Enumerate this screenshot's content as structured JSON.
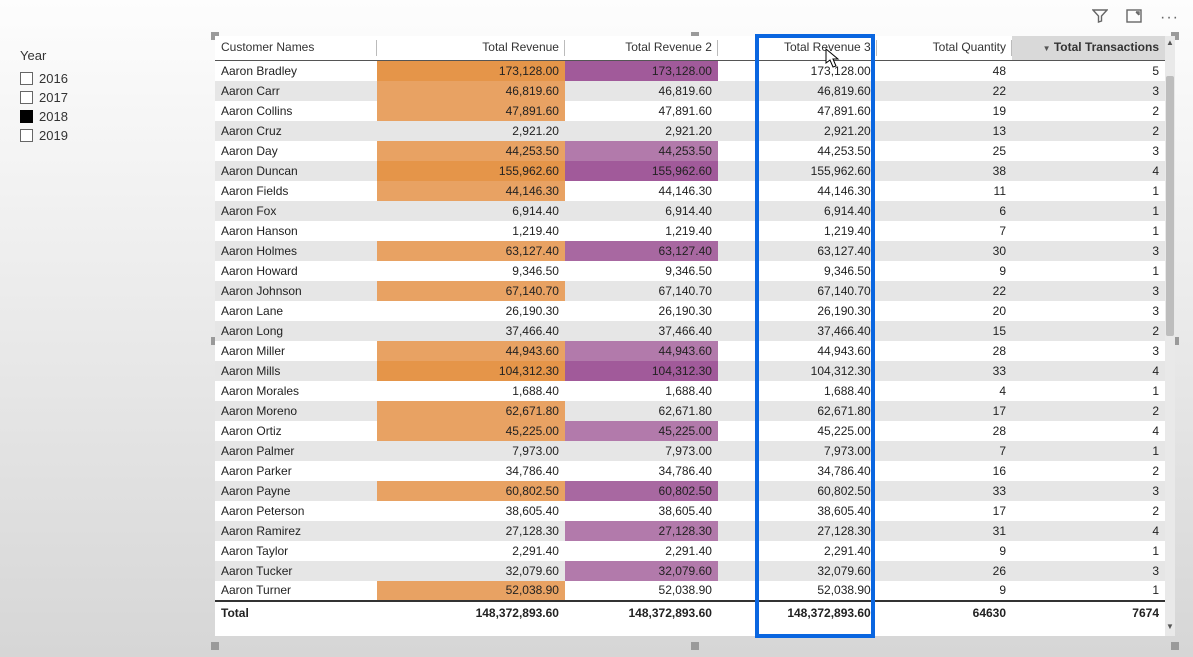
{
  "toolbar": {
    "filter_icon": "filter",
    "focus_icon": "focus-mode",
    "more_icon": "more"
  },
  "slicer": {
    "title": "Year",
    "items": [
      {
        "label": "2016",
        "checked": false
      },
      {
        "label": "2017",
        "checked": false
      },
      {
        "label": "2018",
        "checked": true
      },
      {
        "label": "2019",
        "checked": false
      }
    ]
  },
  "table": {
    "columns": [
      {
        "label": "Customer Names",
        "align": "left"
      },
      {
        "label": "Total Revenue",
        "align": "right"
      },
      {
        "label": "Total Revenue 2",
        "align": "right"
      },
      {
        "label": "Total Revenue 3",
        "align": "right"
      },
      {
        "label": "Total Quantity",
        "align": "right"
      },
      {
        "label": "Total Transactions",
        "align": "right",
        "sorted": true
      }
    ],
    "rows": [
      {
        "name": "Aaron Bradley",
        "rev": "173,128.00",
        "rev2": "173,128.00",
        "rev3": "173,128.00",
        "qty": "48",
        "tx": "5",
        "bg1": "#e59549",
        "bg2": "#a15a9a"
      },
      {
        "name": "Aaron Carr",
        "rev": "46,819.60",
        "rev2": "46,819.60",
        "rev3": "46,819.60",
        "qty": "22",
        "tx": "3",
        "bg1": "#e8a263",
        "bg2": null
      },
      {
        "name": "Aaron Collins",
        "rev": "47,891.60",
        "rev2": "47,891.60",
        "rev3": "47,891.60",
        "qty": "19",
        "tx": "2",
        "bg1": "#e8a263",
        "bg2": null
      },
      {
        "name": "Aaron Cruz",
        "rev": "2,921.20",
        "rev2": "2,921.20",
        "rev3": "2,921.20",
        "qty": "13",
        "tx": "2",
        "bg1": null,
        "bg2": null
      },
      {
        "name": "Aaron Day",
        "rev": "44,253.50",
        "rev2": "44,253.50",
        "rev3": "44,253.50",
        "qty": "25",
        "tx": "3",
        "bg1": "#e8a263",
        "bg2": "#b27aab"
      },
      {
        "name": "Aaron Duncan",
        "rev": "155,962.60",
        "rev2": "155,962.60",
        "rev3": "155,962.60",
        "qty": "38",
        "tx": "4",
        "bg1": "#e59549",
        "bg2": "#a15a9a"
      },
      {
        "name": "Aaron Fields",
        "rev": "44,146.30",
        "rev2": "44,146.30",
        "rev3": "44,146.30",
        "qty": "11",
        "tx": "1",
        "bg1": "#e8a263",
        "bg2": null
      },
      {
        "name": "Aaron Fox",
        "rev": "6,914.40",
        "rev2": "6,914.40",
        "rev3": "6,914.40",
        "qty": "6",
        "tx": "1",
        "bg1": null,
        "bg2": null
      },
      {
        "name": "Aaron Hanson",
        "rev": "1,219.40",
        "rev2": "1,219.40",
        "rev3": "1,219.40",
        "qty": "7",
        "tx": "1",
        "bg1": null,
        "bg2": null
      },
      {
        "name": "Aaron Holmes",
        "rev": "63,127.40",
        "rev2": "63,127.40",
        "rev3": "63,127.40",
        "qty": "30",
        "tx": "3",
        "bg1": "#e8a263",
        "bg2": "#a868a1"
      },
      {
        "name": "Aaron Howard",
        "rev": "9,346.50",
        "rev2": "9,346.50",
        "rev3": "9,346.50",
        "qty": "9",
        "tx": "1",
        "bg1": null,
        "bg2": null
      },
      {
        "name": "Aaron Johnson",
        "rev": "67,140.70",
        "rev2": "67,140.70",
        "rev3": "67,140.70",
        "qty": "22",
        "tx": "3",
        "bg1": "#e8a263",
        "bg2": null
      },
      {
        "name": "Aaron Lane",
        "rev": "26,190.30",
        "rev2": "26,190.30",
        "rev3": "26,190.30",
        "qty": "20",
        "tx": "3",
        "bg1": null,
        "bg2": null
      },
      {
        "name": "Aaron Long",
        "rev": "37,466.40",
        "rev2": "37,466.40",
        "rev3": "37,466.40",
        "qty": "15",
        "tx": "2",
        "bg1": null,
        "bg2": null
      },
      {
        "name": "Aaron Miller",
        "rev": "44,943.60",
        "rev2": "44,943.60",
        "rev3": "44,943.60",
        "qty": "28",
        "tx": "3",
        "bg1": "#e8a263",
        "bg2": "#b27aab"
      },
      {
        "name": "Aaron Mills",
        "rev": "104,312.30",
        "rev2": "104,312.30",
        "rev3": "104,312.30",
        "qty": "33",
        "tx": "4",
        "bg1": "#e59549",
        "bg2": "#a15a9a"
      },
      {
        "name": "Aaron Morales",
        "rev": "1,688.40",
        "rev2": "1,688.40",
        "rev3": "1,688.40",
        "qty": "4",
        "tx": "1",
        "bg1": null,
        "bg2": null
      },
      {
        "name": "Aaron Moreno",
        "rev": "62,671.80",
        "rev2": "62,671.80",
        "rev3": "62,671.80",
        "qty": "17",
        "tx": "2",
        "bg1": "#e8a263",
        "bg2": null
      },
      {
        "name": "Aaron Ortiz",
        "rev": "45,225.00",
        "rev2": "45,225.00",
        "rev3": "45,225.00",
        "qty": "28",
        "tx": "4",
        "bg1": "#e8a263",
        "bg2": "#b27aab"
      },
      {
        "name": "Aaron Palmer",
        "rev": "7,973.00",
        "rev2": "7,973.00",
        "rev3": "7,973.00",
        "qty": "7",
        "tx": "1",
        "bg1": null,
        "bg2": null
      },
      {
        "name": "Aaron Parker",
        "rev": "34,786.40",
        "rev2": "34,786.40",
        "rev3": "34,786.40",
        "qty": "16",
        "tx": "2",
        "bg1": null,
        "bg2": null
      },
      {
        "name": "Aaron Payne",
        "rev": "60,802.50",
        "rev2": "60,802.50",
        "rev3": "60,802.50",
        "qty": "33",
        "tx": "3",
        "bg1": "#e8a263",
        "bg2": "#a868a1"
      },
      {
        "name": "Aaron Peterson",
        "rev": "38,605.40",
        "rev2": "38,605.40",
        "rev3": "38,605.40",
        "qty": "17",
        "tx": "2",
        "bg1": null,
        "bg2": null
      },
      {
        "name": "Aaron Ramirez",
        "rev": "27,128.30",
        "rev2": "27,128.30",
        "rev3": "27,128.30",
        "qty": "31",
        "tx": "4",
        "bg1": null,
        "bg2": "#b27aab"
      },
      {
        "name": "Aaron Taylor",
        "rev": "2,291.40",
        "rev2": "2,291.40",
        "rev3": "2,291.40",
        "qty": "9",
        "tx": "1",
        "bg1": null,
        "bg2": null
      },
      {
        "name": "Aaron Tucker",
        "rev": "32,079.60",
        "rev2": "32,079.60",
        "rev3": "32,079.60",
        "qty": "26",
        "tx": "3",
        "bg1": null,
        "bg2": "#b27aab"
      },
      {
        "name": "Aaron Turner",
        "rev": "52,038.90",
        "rev2": "52,038.90",
        "rev3": "52,038.90",
        "qty": "9",
        "tx": "1",
        "bg1": "#e8a263",
        "bg2": null
      }
    ],
    "totals": {
      "label": "Total",
      "rev": "148,372,893.60",
      "rev2": "148,372,893.60",
      "rev3": "148,372,893.60",
      "qty": "64630",
      "tx": "7674"
    }
  }
}
